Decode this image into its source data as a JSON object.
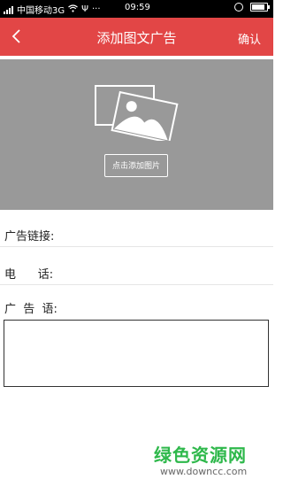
{
  "status_bar": {
    "carrier": "中国移动3G",
    "usb": "Ψ",
    "more": "···",
    "time": "09:59",
    "battery_level": 0.9,
    "icons": [
      "signal-icon",
      "wifi-icon",
      "usb-icon",
      "alarm-icon",
      "battery-icon"
    ]
  },
  "nav": {
    "back_icon": "back-chevron-icon",
    "title": "添加图文广告",
    "confirm_label": "确认"
  },
  "picker": {
    "image_icon": "image-placeholder-icon",
    "add_label": "点击添加图片"
  },
  "form": {
    "link_label": "广告链接:",
    "link_value": "",
    "phone_label": "电      话:",
    "phone_value": "",
    "slogan_label": "广  告  语:",
    "slogan_value": ""
  },
  "watermark": {
    "logo_text": "绿色资源网",
    "url": "www.downcc.com"
  },
  "colors": {
    "accent": "#e24646",
    "picker_bg": "#999999",
    "watermark_green": "#2eb84b"
  }
}
